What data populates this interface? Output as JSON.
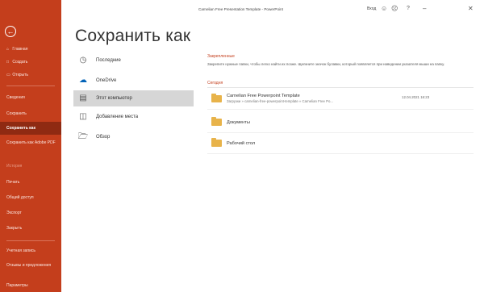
{
  "window": {
    "title": "Carnelian Free Presentation Template - PowerPoint",
    "user": "Вход",
    "icons": [
      "smiley-icon",
      "frown-icon",
      "help-icon",
      "minimize-icon",
      "close-icon"
    ]
  },
  "sidebar": {
    "back_icon": "back-arrow-icon",
    "items": [
      {
        "label": "Главная",
        "icon": "home-icon"
      },
      {
        "label": "Создать",
        "icon": "new-icon"
      },
      {
        "label": "Открыть",
        "icon": "open-icon"
      },
      {
        "label": "Сведения"
      },
      {
        "label": "Сохранить"
      },
      {
        "label": "Сохранить как"
      },
      {
        "label": "Сохранить как Adobe PDF"
      },
      {
        "label": "История"
      },
      {
        "label": "Печать"
      },
      {
        "label": "Общий доступ"
      },
      {
        "label": "Экспорт"
      },
      {
        "label": "Закрыть"
      },
      {
        "label": "Учетная запись"
      },
      {
        "label": "Отзывы и предложения"
      },
      {
        "label": "Параметры"
      }
    ]
  },
  "page_title": "Сохранить как",
  "locations": [
    {
      "label": "Последние",
      "icon": "clock-icon"
    },
    {
      "label": "OneDrive",
      "icon": "cloud-icon"
    },
    {
      "label": "Этот компьютер",
      "icon": "computer-icon"
    },
    {
      "label": "Добавление места",
      "icon": "add-place-icon"
    },
    {
      "label": "Обзор",
      "icon": "folder-browse-icon"
    }
  ],
  "right": {
    "pinned_label": "Закрепленные",
    "pinned_desc": "Закрепите нужные папки, чтобы легко найти их позже. Щелкните значок булавки, который появляется при наведении указателя мыши на папку.",
    "today_label": "Сегодня",
    "folders": [
      {
        "name": "Carnelian Free Powerpoint Template",
        "path": "Загрузки » carnelian-free-powerpoint-template » Carnelian Free Po...",
        "date": "12.04.2021 16:23"
      },
      {
        "name": "Документы",
        "path": "",
        "date": ""
      },
      {
        "name": "Рабочий стол",
        "path": "",
        "date": ""
      }
    ]
  }
}
